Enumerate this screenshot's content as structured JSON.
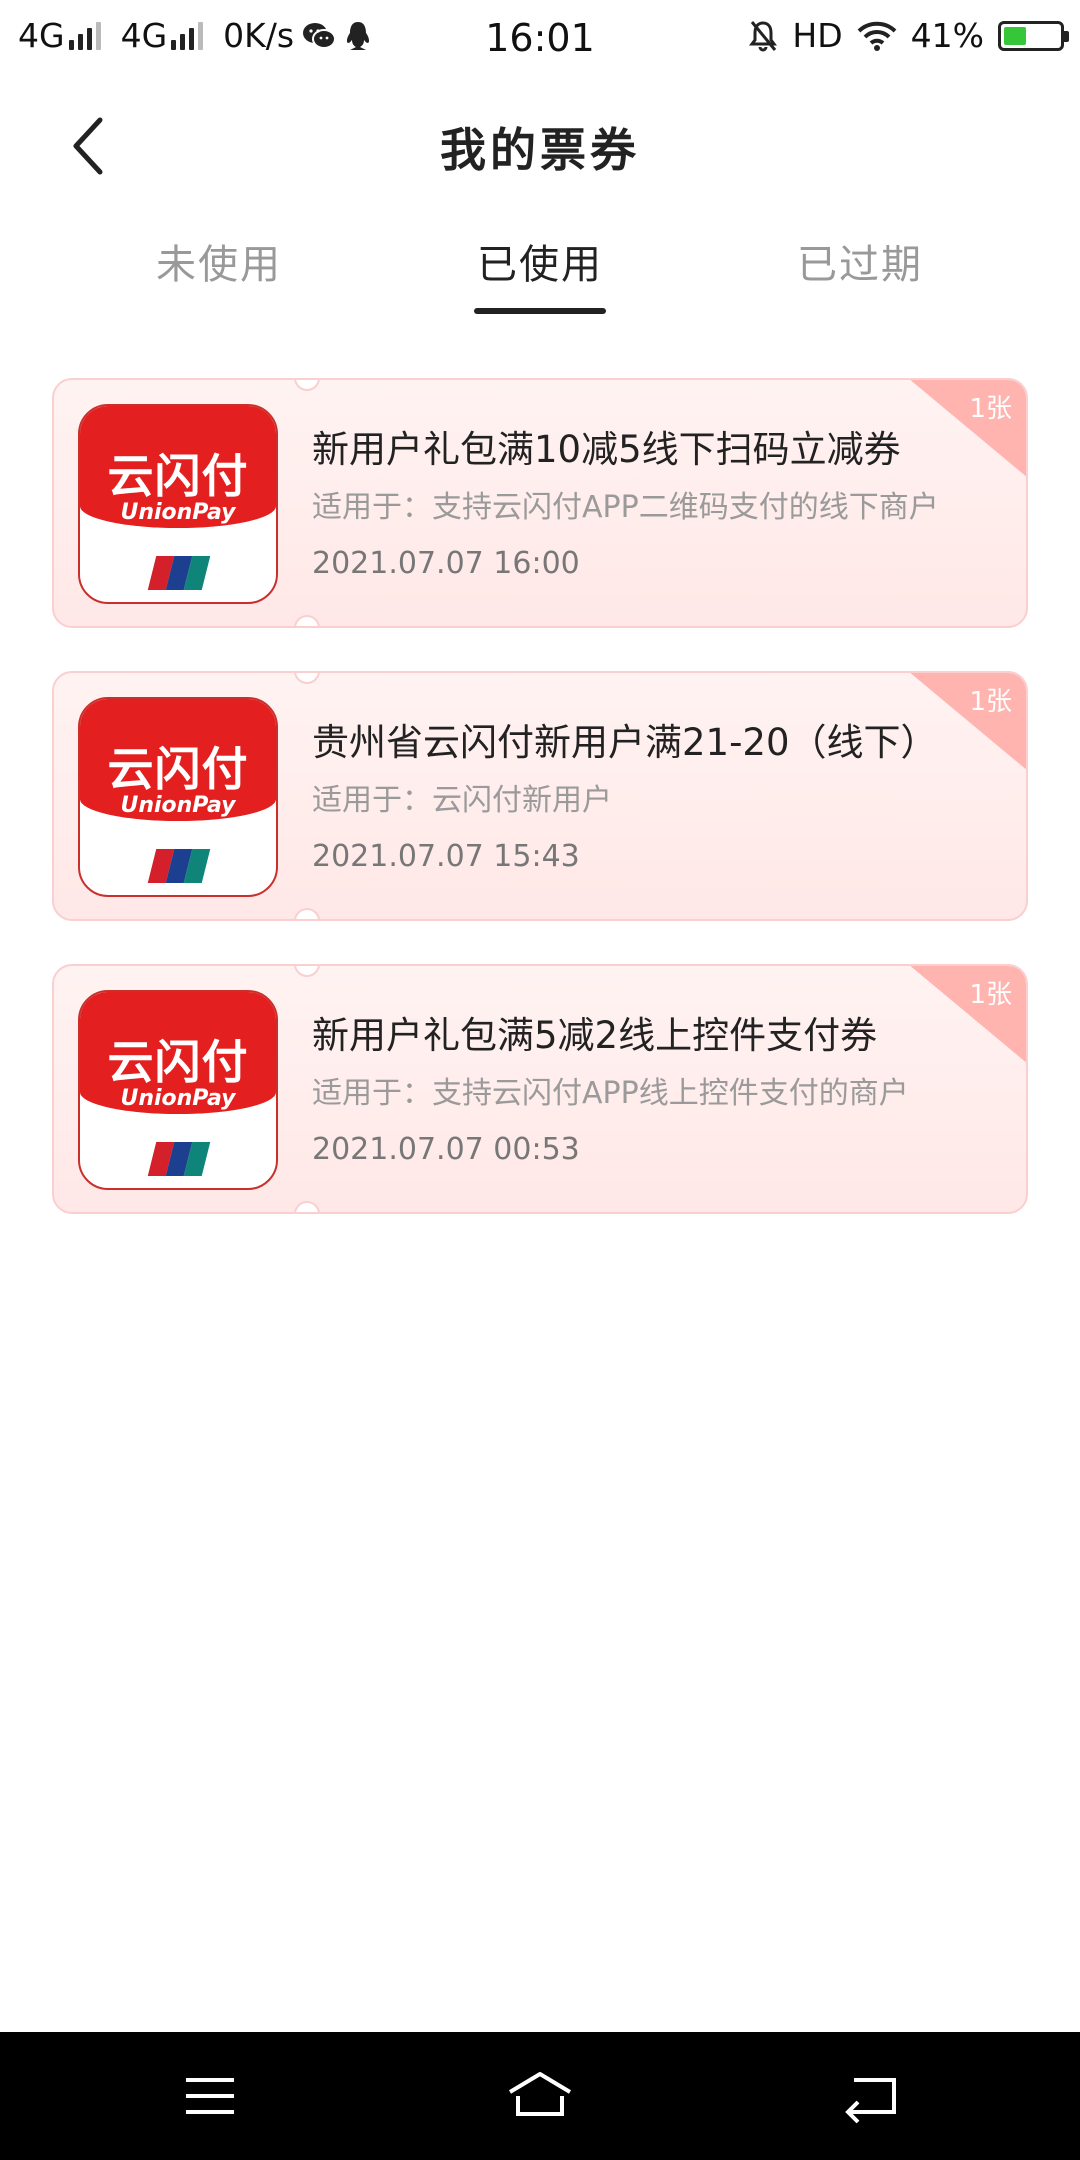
{
  "status_bar": {
    "net1": "4G",
    "net2": "4G",
    "speed": "0K/s",
    "time": "16:01",
    "hd": "HD",
    "battery": "41%",
    "battery_level": 0.41,
    "battery_color": "#35c63a",
    "icons": [
      "wechat-icon",
      "qq-icon",
      "mute-icon",
      "wifi-icon"
    ]
  },
  "header": {
    "title": "我的票券",
    "back_icon": "back-arrow-icon"
  },
  "tabs": [
    {
      "label": "未使用",
      "active": false
    },
    {
      "label": "已使用",
      "active": true
    },
    {
      "label": "已过期",
      "active": false
    }
  ],
  "coupons": [
    {
      "name": "新用户礼包满10减5线下扫码立减券",
      "scope": "适用于：支持云闪付APP二维码支付的线下商户",
      "date": "2021.07.07 16:00",
      "count": "1张",
      "logo_cn": "云闪付",
      "logo_en": "UnionPay"
    },
    {
      "name": "贵州省云闪付新用户满21-20（线下）",
      "scope": "适用于：云闪付新用户",
      "date": "2021.07.07 15:43",
      "count": "1张",
      "logo_cn": "云闪付",
      "logo_en": "UnionPay"
    },
    {
      "name": "新用户礼包满5减2线上控件支付券",
      "scope": "适用于：支持云闪付APP线上控件支付的商户",
      "date": "2021.07.07 00:53",
      "count": "1张",
      "logo_cn": "云闪付",
      "logo_en": "UnionPay"
    }
  ],
  "colors": {
    "accent_red": "#e31f1f",
    "card_border": "#f9cfcf",
    "badge": "#ffb4b0"
  },
  "nav_bar": {
    "icons": [
      "menu-icon",
      "home-icon",
      "back-icon"
    ]
  }
}
